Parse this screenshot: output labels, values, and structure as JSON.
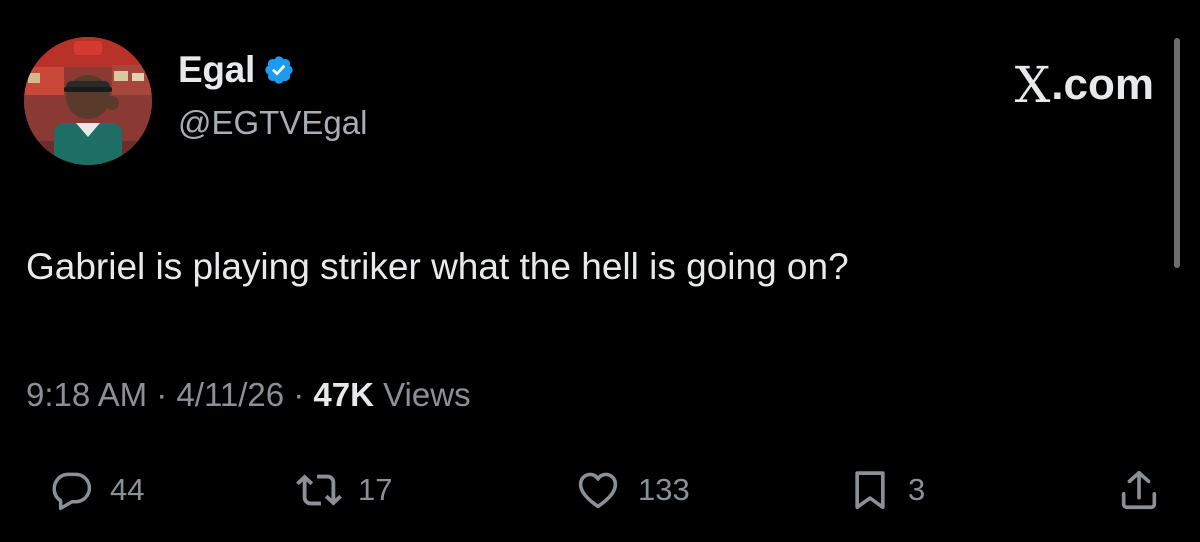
{
  "author": {
    "display_name": "Egal",
    "handle": "@EGTVEgal",
    "verified": true
  },
  "brand": {
    "x_glyph": "X",
    "suffix": ".com"
  },
  "tweet": {
    "text": "Gabriel is playing striker what the hell is going on?",
    "time": "9:18 AM",
    "date": "4/11/26",
    "separator": "·",
    "views_count": "47K",
    "views_label": "Views"
  },
  "actions": {
    "replies": "44",
    "reposts": "17",
    "likes": "133",
    "bookmarks": "3"
  },
  "icons": {
    "reply": "reply-icon",
    "repost": "repost-icon",
    "like": "heart-icon",
    "bookmark": "bookmark-icon",
    "share": "share-icon",
    "verified": "verified-badge-icon"
  },
  "colors": {
    "background": "#000000",
    "text_primary": "#e7e9ea",
    "text_secondary": "#8b9095",
    "verified_blue": "#1d9bf0"
  }
}
